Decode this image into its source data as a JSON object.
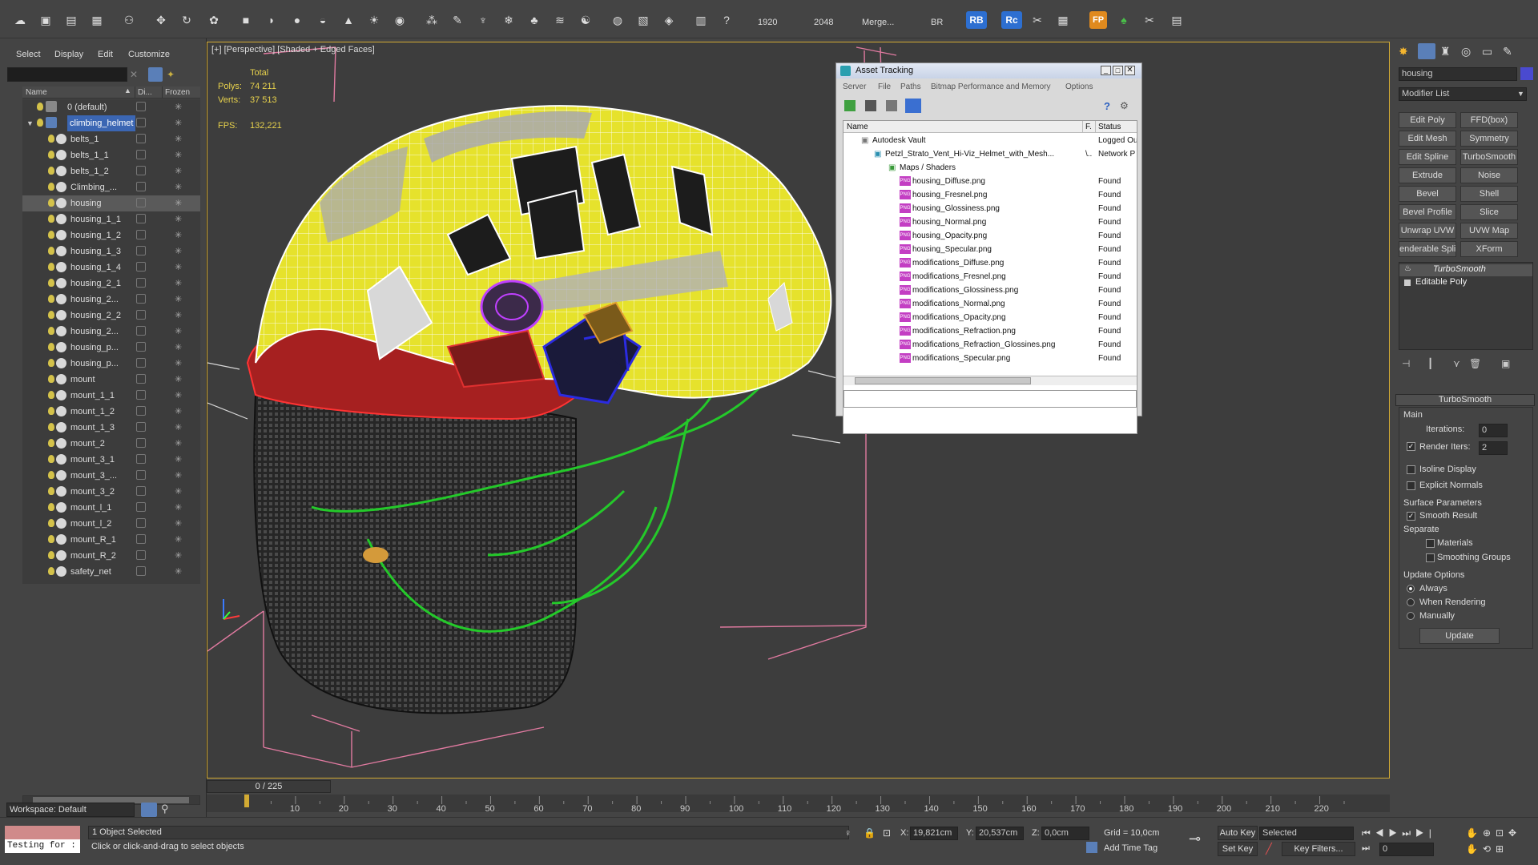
{
  "toolbar": {
    "n1": "1920",
    "n2": "2048",
    "merge": "Merge...",
    "br": "BR",
    "rb": "RB",
    "rc": "Rc",
    "fp": "FP"
  },
  "scene": {
    "menu": [
      "Select",
      "Display",
      "Edit",
      "Customize"
    ],
    "columns": {
      "name": "Name",
      "display": "Di...",
      "frozen": "Frozen"
    },
    "rows": [
      "0 (default)",
      "climbing_helmet",
      "belts_1",
      "belts_1_1",
      "belts_1_2",
      "Climbing_...",
      "housing",
      "housing_1_1",
      "housing_1_2",
      "housing_1_3",
      "housing_1_4",
      "housing_2_1",
      "housing_2...",
      "housing_2_2",
      "housing_2...",
      "housing_p...",
      "housing_p...",
      "mount",
      "mount_1_1",
      "mount_1_2",
      "mount_1_3",
      "mount_2",
      "mount_3_1",
      "mount_3_...",
      "mount_3_2",
      "mount_l_1",
      "mount_l_2",
      "mount_R_1",
      "mount_R_2",
      "safety_net"
    ],
    "workspace": "Workspace: Default"
  },
  "viewport": {
    "label": "[+] [Perspective] [Shaded + Edged Faces]",
    "stats": {
      "total": "Total",
      "polys_label": "Polys:",
      "polys": "74 211",
      "verts_label": "Verts:",
      "verts": "37 513",
      "fps_label": "FPS:",
      "fps": "132,221"
    }
  },
  "asset": {
    "title": "Asset Tracking",
    "menu": [
      "Server",
      "File",
      "Paths",
      "Bitmap Performance and Memory",
      "Options"
    ],
    "cols": {
      "name": "Name",
      "f": "F.",
      "status": "Status"
    },
    "vault": "Autodesk Vault",
    "vault_status": "Logged Ou",
    "file": "Petzl_Strato_Vent_Hi-Viz_Helmet_with_Mesh...",
    "file_f": "\\..",
    "file_status": "Network P",
    "maps": "Maps / Shaders",
    "textures": [
      "housing_Diffuse.png",
      "housing_Fresnel.png",
      "housing_Glossiness.png",
      "housing_Normal.png",
      "housing_Opacity.png",
      "housing_Specular.png",
      "modifications_Diffuse.png",
      "modifications_Fresnel.png",
      "modifications_Glossiness.png",
      "modifications_Normal.png",
      "modifications_Opacity.png",
      "modifications_Refraction.png",
      "modifications_Refraction_Glossines.png",
      "modifications_Specular.png"
    ],
    "found": "Found"
  },
  "cmd": {
    "obj_name": "housing",
    "modlist": "Modifier List",
    "buttons": [
      "Edit Poly",
      "FFD(box)",
      "Edit Mesh",
      "Symmetry",
      "Edit Spline",
      "TurboSmooth",
      "Extrude",
      "Noise",
      "Bevel",
      "Shell",
      "Bevel Profile",
      "Slice",
      "Unwrap UVW",
      "UVW Map",
      "enderable Splin",
      "XForm"
    ],
    "stack": [
      "TurboSmooth",
      "Editable Poly"
    ],
    "ts": {
      "title": "TurboSmooth",
      "main": "Main",
      "iter_label": "Iterations:",
      "iter": "0",
      "render_label": "Render Iters:",
      "render": "2",
      "isoline": "Isoline Display",
      "explicit": "Explicit Normals",
      "surface": "Surface Parameters",
      "smooth": "Smooth Result",
      "separate": "Separate",
      "materials": "Materials",
      "groups": "Smoothing Groups",
      "update_opts": "Update Options",
      "always": "Always",
      "when": "When Rendering",
      "manually": "Manually",
      "update": "Update"
    }
  },
  "timeline": {
    "frame": "0 / 225",
    "ticks": [
      "10",
      "20",
      "30",
      "40",
      "50",
      "60",
      "70",
      "80",
      "90",
      "100",
      "110",
      "120",
      "130",
      "140",
      "150",
      "160",
      "170",
      "180",
      "190",
      "200",
      "210",
      "220"
    ]
  },
  "status": {
    "script": "Testing for :",
    "selected": "1 Object Selected",
    "hint": "Click or click-and-drag to select objects",
    "x_label": "X:",
    "x": "19,821cm",
    "y_label": "Y:",
    "y": "20,537cm",
    "z_label": "Z:",
    "z": "0,0cm",
    "grid": "Grid = 10,0cm",
    "addtag": "Add Time Tag",
    "autokey": "Auto Key",
    "setkey": "Set Key",
    "sel_dropdown": "Selected",
    "keyfilters": "Key Filters...",
    "frame": "0"
  },
  "colors": {
    "accent": "#2d6fd1",
    "viewport_border": "#d2aa33",
    "helmet": "#e6e22c"
  }
}
